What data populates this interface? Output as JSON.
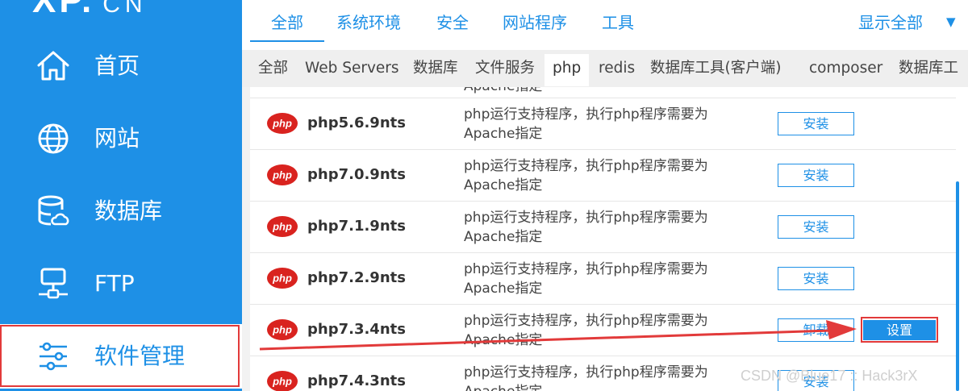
{
  "brand": {
    "logo": "XP.",
    "logo_suffix": "CN"
  },
  "sidebar": {
    "items": [
      {
        "label": "首页",
        "icon": "home-icon"
      },
      {
        "label": "网站",
        "icon": "globe-icon"
      },
      {
        "label": "数据库",
        "icon": "database-icon"
      },
      {
        "label": "FTP",
        "icon": "ftp-server-icon"
      },
      {
        "label": "软件管理",
        "icon": "sliders-icon",
        "active": true
      }
    ]
  },
  "main_tabs": {
    "items": [
      "全部",
      "系统环境",
      "安全",
      "网站程序",
      "工具"
    ],
    "active": "全部",
    "show_all": "显示全部",
    "show_all_icon": "triangle-down-icon"
  },
  "sub_tabs": {
    "items": [
      "全部",
      "Web Servers",
      "数据库",
      "文件服务",
      "php",
      "redis",
      "数据库工具(客户端)",
      "composer",
      "数据库工"
    ],
    "active": "php"
  },
  "list": {
    "clipped_row_text": "Apache指定",
    "rows": [
      {
        "name": "php5.6.9nts",
        "desc_line1": "php运行支持程序，执行php程序需要为",
        "desc_line2": "Apache指定",
        "button": "安装"
      },
      {
        "name": "php7.0.9nts",
        "desc_line1": "php运行支持程序，执行php程序需要为",
        "desc_line2": "Apache指定",
        "button": "安装"
      },
      {
        "name": "php7.1.9nts",
        "desc_line1": "php运行支持程序，执行php程序需要为",
        "desc_line2": "Apache指定",
        "button": "安装"
      },
      {
        "name": "php7.2.9nts",
        "desc_line1": "php运行支持程序，执行php程序需要为",
        "desc_line2": "Apache指定",
        "button": "安装"
      },
      {
        "name": "php7.3.4nts",
        "desc_line1": "php运行支持程序，执行php程序需要为",
        "desc_line2": "Apache指定",
        "button": "卸载",
        "settings_button": "设置"
      },
      {
        "name": "php7.4.3nts",
        "desc_line1": "php运行支持程序，执行php程序需要为",
        "desc_line2": "Apache指定",
        "button": "安装"
      }
    ]
  },
  "logo_badge_text": "php",
  "colors": {
    "brand_blue": "#1e90e6",
    "annotation_red": "#e23a3a",
    "php_red": "#d9231f"
  },
  "watermark": "CSDN @Blue17 :: Hack3rX"
}
